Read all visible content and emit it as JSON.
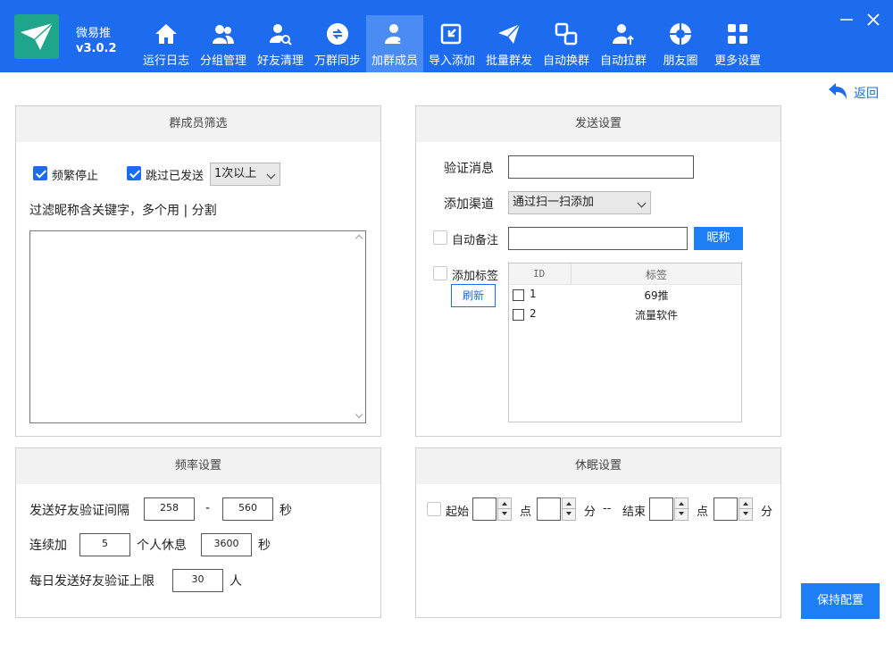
{
  "app": {
    "name": "微易推",
    "version": "v3.0.2"
  },
  "nav": [
    {
      "label": "运行日志",
      "icon": "home-icon"
    },
    {
      "label": "分组管理",
      "icon": "group-icon"
    },
    {
      "label": "好友清理",
      "icon": "user-search-icon"
    },
    {
      "label": "万群同步",
      "icon": "sync-icon"
    },
    {
      "label": "加群成员",
      "icon": "user-add-icon"
    },
    {
      "label": "导入添加",
      "icon": "import-icon"
    },
    {
      "label": "批量群发",
      "icon": "send-icon"
    },
    {
      "label": "自动换群",
      "icon": "switch-icon"
    },
    {
      "label": "自动拉群",
      "icon": "pull-user-icon"
    },
    {
      "label": "朋友圈",
      "icon": "camera-aperture-icon"
    },
    {
      "label": "更多设置",
      "icon": "grid-icon"
    }
  ],
  "active_nav": "加群成员",
  "back_label": "返回",
  "member_filter": {
    "title": "群成员筛选",
    "freq_stop_label": "频繁停止",
    "skip_sent_label": "跳过已发送",
    "skip_sent_option": "1次以上",
    "keyword_label": "过滤昵称含关键字，多个用 | 分割",
    "keyword_value": ""
  },
  "send_settings": {
    "title": "发送设置",
    "verify_label": "验证消息",
    "verify_value": "",
    "channel_label": "添加渠道",
    "channel_value": "通过扫一扫添加",
    "auto_remark_label": "自动备注",
    "auto_remark_value": "",
    "nickname_button": "昵称",
    "add_tag_label": "添加标签",
    "refresh_button": "刷新",
    "tag_columns": [
      "ID",
      "标签"
    ],
    "tags": [
      {
        "id": "1",
        "name": "69推"
      },
      {
        "id": "2",
        "name": "流量软件"
      }
    ]
  },
  "rate_settings": {
    "title": "频率设置",
    "interval_label": "发送好友验证间隔",
    "interval_min": "258",
    "dash": "-",
    "interval_max": "560",
    "sec_unit": "秒",
    "continuous_label": "连续加",
    "continuous_value": "5",
    "rest_label": "个人休息",
    "rest_value": "3600",
    "rest_unit": "秒",
    "daily_label": "每日发送好友验证上限",
    "daily_value": "30",
    "person_unit": "人"
  },
  "sleep_settings": {
    "title": "休眠设置",
    "start_label": "起始",
    "hour_unit": "点",
    "minute_unit": "分",
    "separator": "--",
    "end_label": "结束",
    "end_hour_unit": "点",
    "end_minute_unit": "分"
  },
  "save_button": "保持配置",
  "colors": {
    "primary": "#1d6cf0",
    "nav_active": "#4a8bf4",
    "logo": "#1ea58a"
  }
}
